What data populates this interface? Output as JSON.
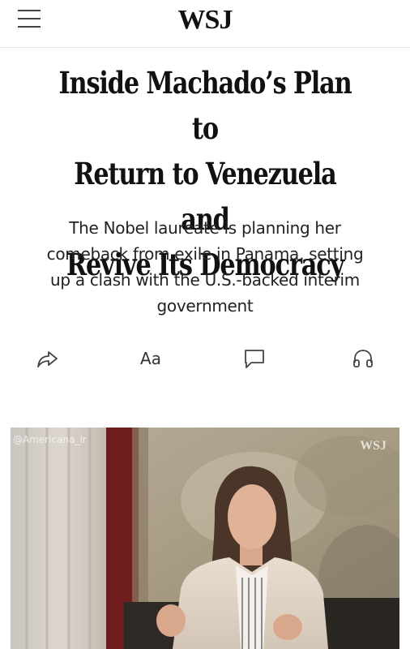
{
  "header": {
    "menu_icon": "hamburger-menu-icon",
    "logo": "WSJ"
  },
  "article": {
    "headline_lines": [
      "Inside Machado’s Plan to",
      "Return to Venezuela and",
      "Revive Its Democracy"
    ],
    "dek_lines": [
      "The Nobel laureate is planning her",
      "comeback from exile in Panama, setting",
      "up a clash with the U.S.-backed interim",
      "government"
    ]
  },
  "toolbar": {
    "share_icon": "share-icon",
    "text_size_label": "Aa",
    "comments_icon": "comment-icon",
    "listen_icon": "headphones-icon"
  },
  "image": {
    "watermark": "@Americana_ir",
    "logo": "WSJ"
  },
  "colors": {
    "text": "#111111",
    "divider": "#e3e3e3",
    "icon": "#444444"
  }
}
